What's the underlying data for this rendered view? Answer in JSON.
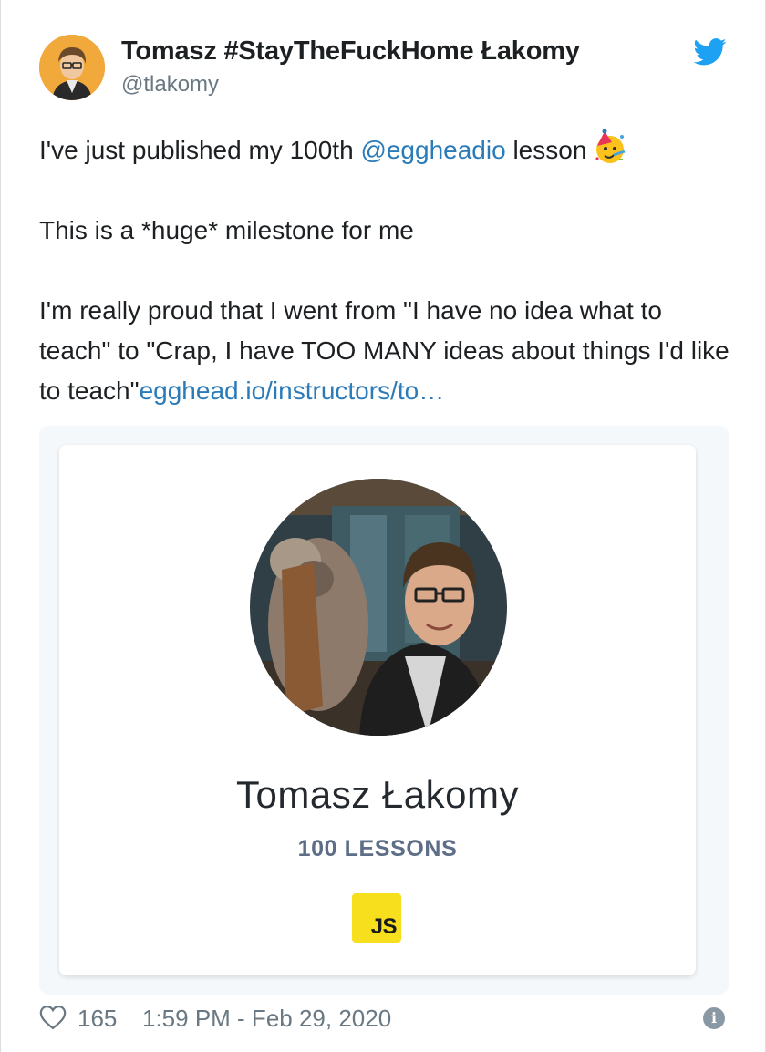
{
  "author": {
    "name": "Tomasz #StayTheFuckHome Łakomy",
    "handle": "@tlakomy"
  },
  "icons": {
    "brand": "twitter-bird-icon",
    "emoji": "partying-face-icon",
    "like": "heart-icon",
    "info": "info-icon"
  },
  "colors": {
    "link": "#2b7bb9",
    "twitter_blue": "#1da1f2",
    "muted": "#697882",
    "js_yellow": "#f7df1e"
  },
  "tweet": {
    "line1_pre": "I've just published my 100th ",
    "mention": "@eggheadio",
    "line1_post": " lesson",
    "line2": "This is a *huge* milestone for me",
    "line3": "I'm really proud that I went from \"I have no idea what to teach\" to \"Crap, I have TOO MANY ideas about things I'd like to teach\"",
    "link": "egghead.io/instructors/to…"
  },
  "card": {
    "name": "Tomasz Łakomy",
    "lessons": "100 LESSONS",
    "badge": "JS"
  },
  "footer": {
    "likes": "165",
    "timestamp": "1:59 PM - Feb 29, 2020",
    "info_glyph": "i"
  }
}
